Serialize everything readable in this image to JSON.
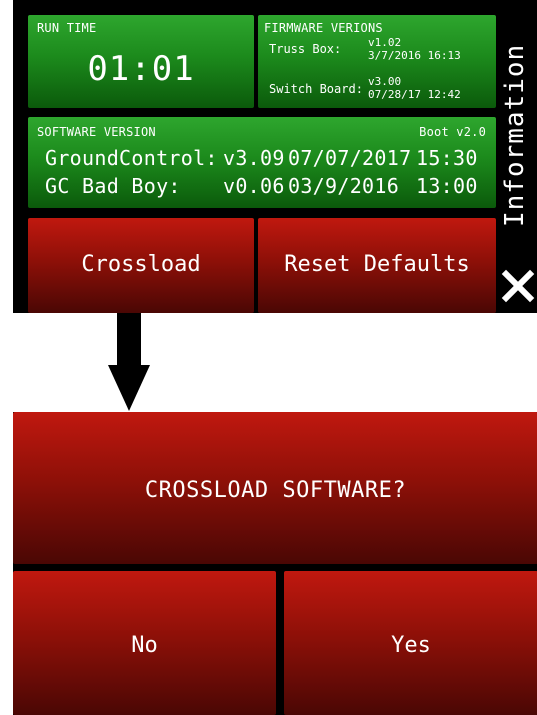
{
  "top_screen": {
    "runtime": {
      "label": "RUN TIME",
      "value": "01:01"
    },
    "firmware": {
      "label": "FIRMWARE VERIONS",
      "truss_box": {
        "label": "Truss Box:",
        "version": "v1.02",
        "date": "3/7/2016 16:13"
      },
      "switch_board": {
        "label": "Switch Board:",
        "version": "v3.00",
        "date": "07/28/17 12:42"
      }
    },
    "software": {
      "label": "SOFTWARE VERSION",
      "boot": "Boot v2.0",
      "rows": [
        {
          "name": "GroundControl:",
          "version": "v3.09",
          "date": "07/07/2017",
          "time": "15:30"
        },
        {
          "name": "GC Bad Boy:",
          "version": "v0.06",
          "date": "03/9/2016",
          "time": "13:00"
        }
      ]
    },
    "buttons": {
      "crossload": "Crossload",
      "reset_defaults": "Reset Defaults"
    },
    "side_title": "Information",
    "close_icon": "close-icon"
  },
  "arrow_icon": "arrow-down-icon",
  "dialog": {
    "title": "CROSSLOAD SOFTWARE?",
    "no": "No",
    "yes": "Yes"
  },
  "colors": {
    "green_top": "#2ea62e",
    "green_bottom": "#0b5a0b",
    "red_top": "#c0180f",
    "red_bottom": "#4a0704",
    "background": "#000000"
  }
}
